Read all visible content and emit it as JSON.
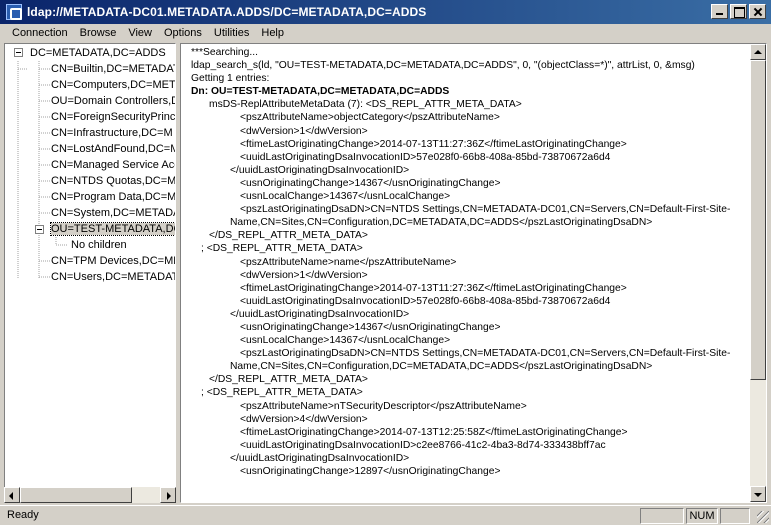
{
  "window": {
    "title": "ldap://METADATA-DC01.METADATA.ADDS/DC=METADATA,DC=ADDS",
    "app_icon_label": "ldap"
  },
  "menu": [
    "Connection",
    "Browse",
    "View",
    "Options",
    "Utilities",
    "Help"
  ],
  "tree": {
    "root": "DC=METADATA,DC=ADDS",
    "items": [
      "CN=Builtin,DC=METADAT",
      "CN=Computers,DC=META",
      "OU=Domain Controllers,D",
      "CN=ForeignSecurityPrincip",
      "CN=Infrastructure,DC=M",
      "CN=LostAndFound,DC=M",
      "CN=Managed Service Acc",
      "CN=NTDS Quotas,DC=ME",
      "CN=Program Data,DC=MI",
      "CN=System,DC=METADAT",
      "OU=TEST-METADATA,DC"
    ],
    "selected_child": "No children",
    "items_after": [
      "CN=TPM Devices,DC=ME",
      "CN=Users,DC=METADATA"
    ]
  },
  "output": {
    "lines": [
      {
        "text": "***Searching...",
        "bold": false,
        "indent": 0
      },
      {
        "text": "ldap_search_s(ld, \"OU=TEST-METADATA,DC=METADATA,DC=ADDS\", 0, \"(objectClass=*)\", attrList,  0, &msg)",
        "bold": false,
        "indent": 0
      },
      {
        "text": "Getting 1 entries:",
        "bold": false,
        "indent": 0
      },
      {
        "text": "Dn: OU=TEST-METADATA,DC=METADATA,DC=ADDS",
        "bold": true,
        "indent": 0
      },
      {
        "text": "msDS-ReplAttributeMetaData (7): <DS_REPL_ATTR_META_DATA>",
        "bold": false,
        "indent": 1
      },
      {
        "text": "<pszAttributeName>objectCategory</pszAttributeName>",
        "bold": false,
        "indent": 3
      },
      {
        "text": "<dwVersion>1</dwVersion>",
        "bold": false,
        "indent": 3
      },
      {
        "text": "<ftimeLastOriginatingChange>2014-07-13T11:27:36Z</ftimeLastOriginatingChange>",
        "bold": false,
        "indent": 3
      },
      {
        "text": "<uuidLastOriginatingDsaInvocationID>57e028f0-66b8-408a-85bd-73870672a6d4",
        "bold": false,
        "indent": 3
      },
      {
        "text": "</uuidLastOriginatingDsaInvocationID>",
        "bold": false,
        "indent": 2
      },
      {
        "text": "<usnOriginatingChange>14367</usnOriginatingChange>",
        "bold": false,
        "indent": 3
      },
      {
        "text": "<usnLocalChange>14367</usnLocalChange>",
        "bold": false,
        "indent": 3
      },
      {
        "text": "<pszLastOriginatingDsaDN>CN=NTDS Settings,CN=METADATA-DC01,CN=Servers,CN=Default-First-Site-",
        "bold": false,
        "indent": 3
      },
      {
        "text": "Name,CN=Sites,CN=Configuration,DC=METADATA,DC=ADDS</pszLastOriginatingDsaDN>",
        "bold": false,
        "indent": 2
      },
      {
        "text": "</DS_REPL_ATTR_META_DATA>",
        "bold": false,
        "indent": 1
      },
      {
        "text": "; <DS_REPL_ATTR_META_DATA>",
        "bold": false,
        "indent": 1.1
      },
      {
        "text": "<pszAttributeName>name</pszAttributeName>",
        "bold": false,
        "indent": 3
      },
      {
        "text": "<dwVersion>1</dwVersion>",
        "bold": false,
        "indent": 3
      },
      {
        "text": "<ftimeLastOriginatingChange>2014-07-13T11:27:36Z</ftimeLastOriginatingChange>",
        "bold": false,
        "indent": 3
      },
      {
        "text": "<uuidLastOriginatingDsaInvocationID>57e028f0-66b8-408a-85bd-73870672a6d4",
        "bold": false,
        "indent": 3
      },
      {
        "text": "</uuidLastOriginatingDsaInvocationID>",
        "bold": false,
        "indent": 2
      },
      {
        "text": "<usnOriginatingChange>14367</usnOriginatingChange>",
        "bold": false,
        "indent": 3
      },
      {
        "text": "<usnLocalChange>14367</usnLocalChange>",
        "bold": false,
        "indent": 3
      },
      {
        "text": "<pszLastOriginatingDsaDN>CN=NTDS Settings,CN=METADATA-DC01,CN=Servers,CN=Default-First-Site-",
        "bold": false,
        "indent": 3
      },
      {
        "text": "Name,CN=Sites,CN=Configuration,DC=METADATA,DC=ADDS</pszLastOriginatingDsaDN>",
        "bold": false,
        "indent": 2
      },
      {
        "text": "</DS_REPL_ATTR_META_DATA>",
        "bold": false,
        "indent": 1
      },
      {
        "text": "; <DS_REPL_ATTR_META_DATA>",
        "bold": false,
        "indent": 1.1
      },
      {
        "text": "<pszAttributeName>nTSecurityDescriptor</pszAttributeName>",
        "bold": false,
        "indent": 3
      },
      {
        "text": "<dwVersion>4</dwVersion>",
        "bold": false,
        "indent": 3
      },
      {
        "text": "<ftimeLastOriginatingChange>2014-07-13T12:25:58Z</ftimeLastOriginatingChange>",
        "bold": false,
        "indent": 3
      },
      {
        "text": "<uuidLastOriginatingDsaInvocationID>c2ee8766-41c2-4ba3-8d74-333438bff7ac",
        "bold": false,
        "indent": 3
      },
      {
        "text": "</uuidLastOriginatingDsaInvocationID>",
        "bold": false,
        "indent": 2
      },
      {
        "text": "<usnOriginatingChange>12897</usnOriginatingChange>",
        "bold": false,
        "indent": 3
      }
    ]
  },
  "status": {
    "text": "Ready",
    "num": "NUM"
  }
}
